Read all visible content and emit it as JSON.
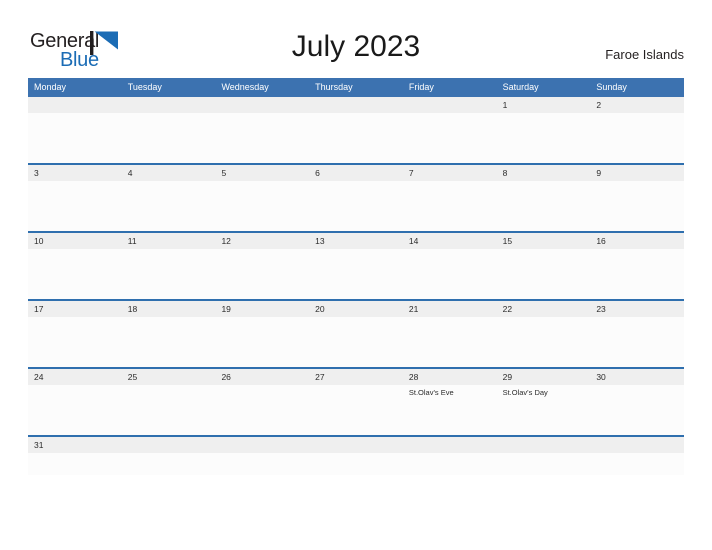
{
  "brand": {
    "name_part1": "General",
    "name_part2": "Blue",
    "flag_icon": "flag-triangle-icon",
    "color_dark": "#231f20",
    "color_blue": "#1b6cb5"
  },
  "header": {
    "title": "July 2023",
    "region": "Faroe Islands"
  },
  "theme": {
    "header_blue": "#3c72b0",
    "row_divider_blue": "#2f6fae",
    "date_strip_gray": "#efefef",
    "cell_white": "#fcfcfc",
    "text_dark": "#2b2b2b"
  },
  "calendar": {
    "weekdays": [
      "Monday",
      "Tuesday",
      "Wednesday",
      "Thursday",
      "Friday",
      "Saturday",
      "Sunday"
    ],
    "weeks": [
      {
        "days": [
          {
            "date": "",
            "events": []
          },
          {
            "date": "",
            "events": []
          },
          {
            "date": "",
            "events": []
          },
          {
            "date": "",
            "events": []
          },
          {
            "date": "",
            "events": []
          },
          {
            "date": "1",
            "events": []
          },
          {
            "date": "2",
            "events": []
          }
        ]
      },
      {
        "days": [
          {
            "date": "3",
            "events": []
          },
          {
            "date": "4",
            "events": []
          },
          {
            "date": "5",
            "events": []
          },
          {
            "date": "6",
            "events": []
          },
          {
            "date": "7",
            "events": []
          },
          {
            "date": "8",
            "events": []
          },
          {
            "date": "9",
            "events": []
          }
        ]
      },
      {
        "days": [
          {
            "date": "10",
            "events": []
          },
          {
            "date": "11",
            "events": []
          },
          {
            "date": "12",
            "events": []
          },
          {
            "date": "13",
            "events": []
          },
          {
            "date": "14",
            "events": []
          },
          {
            "date": "15",
            "events": []
          },
          {
            "date": "16",
            "events": []
          }
        ]
      },
      {
        "days": [
          {
            "date": "17",
            "events": []
          },
          {
            "date": "18",
            "events": []
          },
          {
            "date": "19",
            "events": []
          },
          {
            "date": "20",
            "events": []
          },
          {
            "date": "21",
            "events": []
          },
          {
            "date": "22",
            "events": []
          },
          {
            "date": "23",
            "events": []
          }
        ]
      },
      {
        "days": [
          {
            "date": "24",
            "events": []
          },
          {
            "date": "25",
            "events": []
          },
          {
            "date": "26",
            "events": []
          },
          {
            "date": "27",
            "events": []
          },
          {
            "date": "28",
            "events": [
              "St.Olav's Eve"
            ]
          },
          {
            "date": "29",
            "events": [
              "St.Olav's Day"
            ]
          },
          {
            "date": "30",
            "events": []
          }
        ]
      },
      {
        "days": [
          {
            "date": "31",
            "events": []
          },
          {
            "date": "",
            "events": []
          },
          {
            "date": "",
            "events": []
          },
          {
            "date": "",
            "events": []
          },
          {
            "date": "",
            "events": []
          },
          {
            "date": "",
            "events": []
          },
          {
            "date": "",
            "events": []
          }
        ]
      }
    ]
  }
}
